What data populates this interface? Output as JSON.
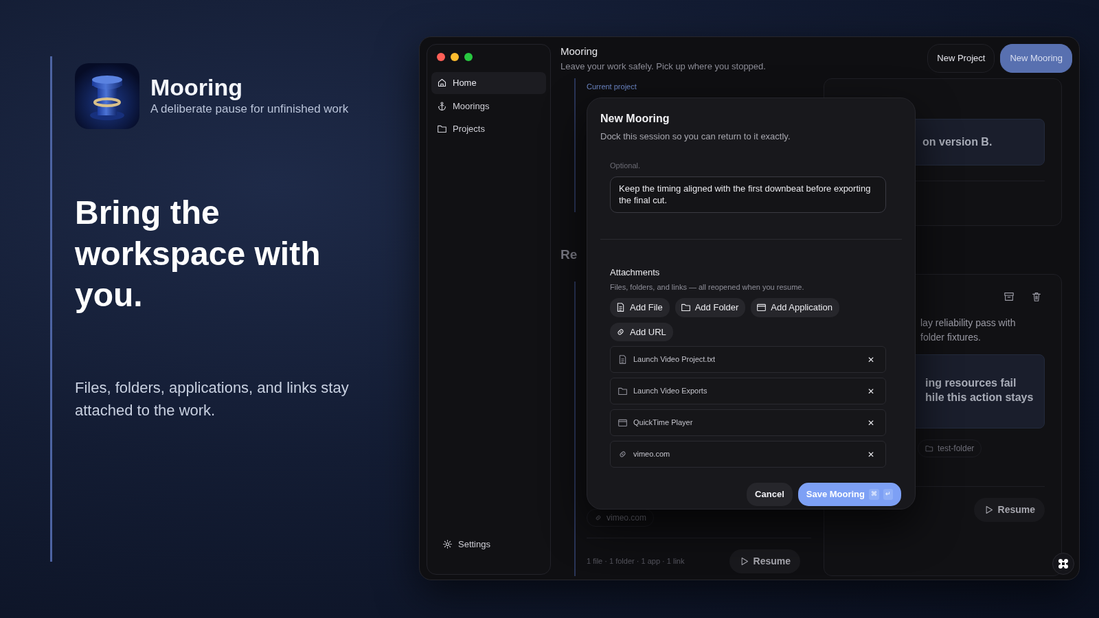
{
  "hero": {
    "app_name": "Mooring",
    "tagline": "A deliberate pause for unfinished work",
    "headline": "Bring the workspace with you.",
    "description": "Files, folders, applications, and links stay attached to the work."
  },
  "window": {
    "sidebar": {
      "items": [
        {
          "label": "Home",
          "kind": "home",
          "selected": true
        },
        {
          "label": "Moorings",
          "kind": "anchor",
          "selected": false
        },
        {
          "label": "Projects",
          "kind": "folder",
          "selected": false
        }
      ],
      "footer_item": {
        "label": "Settings",
        "kind": "gear"
      }
    },
    "header": {
      "title": "Mooring",
      "subtitle": "Leave your work safely. Pick up where you stopped.",
      "buttons": [
        {
          "label": "New Project",
          "primary": false
        },
        {
          "label": "New Mooring",
          "primary": true
        }
      ]
    },
    "background": {
      "current_project_label": "Current project",
      "section_heading": "Re",
      "left_card": {
        "chip": "vimeo.com",
        "summary": "1 file · 1 folder · 1 app · 1 link",
        "action": "Resume"
      },
      "top_card": {
        "note": "on version B."
      },
      "bottom_card": {
        "description_lines": [
          "lay reliability pass with",
          "folder fixtures."
        ],
        "note_lines": [
          "ing resources fail",
          "hile this action stays"
        ],
        "chip": "test-folder",
        "action": "Resume"
      }
    },
    "dialog": {
      "title": "New Mooring",
      "subtitle": "Dock this session so you can return to it exactly.",
      "field_label": "Optional.",
      "note_value": "Keep the timing aligned with the first downbeat before exporting the final cut.",
      "attachments_title": "Attachments",
      "attachments_hint": "Files, folders, and links — all reopened when you resume.",
      "add_buttons": [
        {
          "label": "Add File",
          "kind": "file"
        },
        {
          "label": "Add Folder",
          "kind": "folder"
        },
        {
          "label": "Add Application",
          "kind": "app"
        },
        {
          "label": "Add URL",
          "kind": "link"
        }
      ],
      "attachments": [
        {
          "name": "Launch Video Project.txt",
          "kind": "file"
        },
        {
          "name": "Launch Video Exports",
          "kind": "folder"
        },
        {
          "name": "QuickTime Player",
          "kind": "app"
        },
        {
          "name": "vimeo.com",
          "kind": "link"
        }
      ],
      "remove_label": "✕",
      "cancel": "Cancel",
      "save": {
        "label": "Save Mooring",
        "shortcut": [
          "⌘",
          "↵"
        ]
      }
    }
  }
}
